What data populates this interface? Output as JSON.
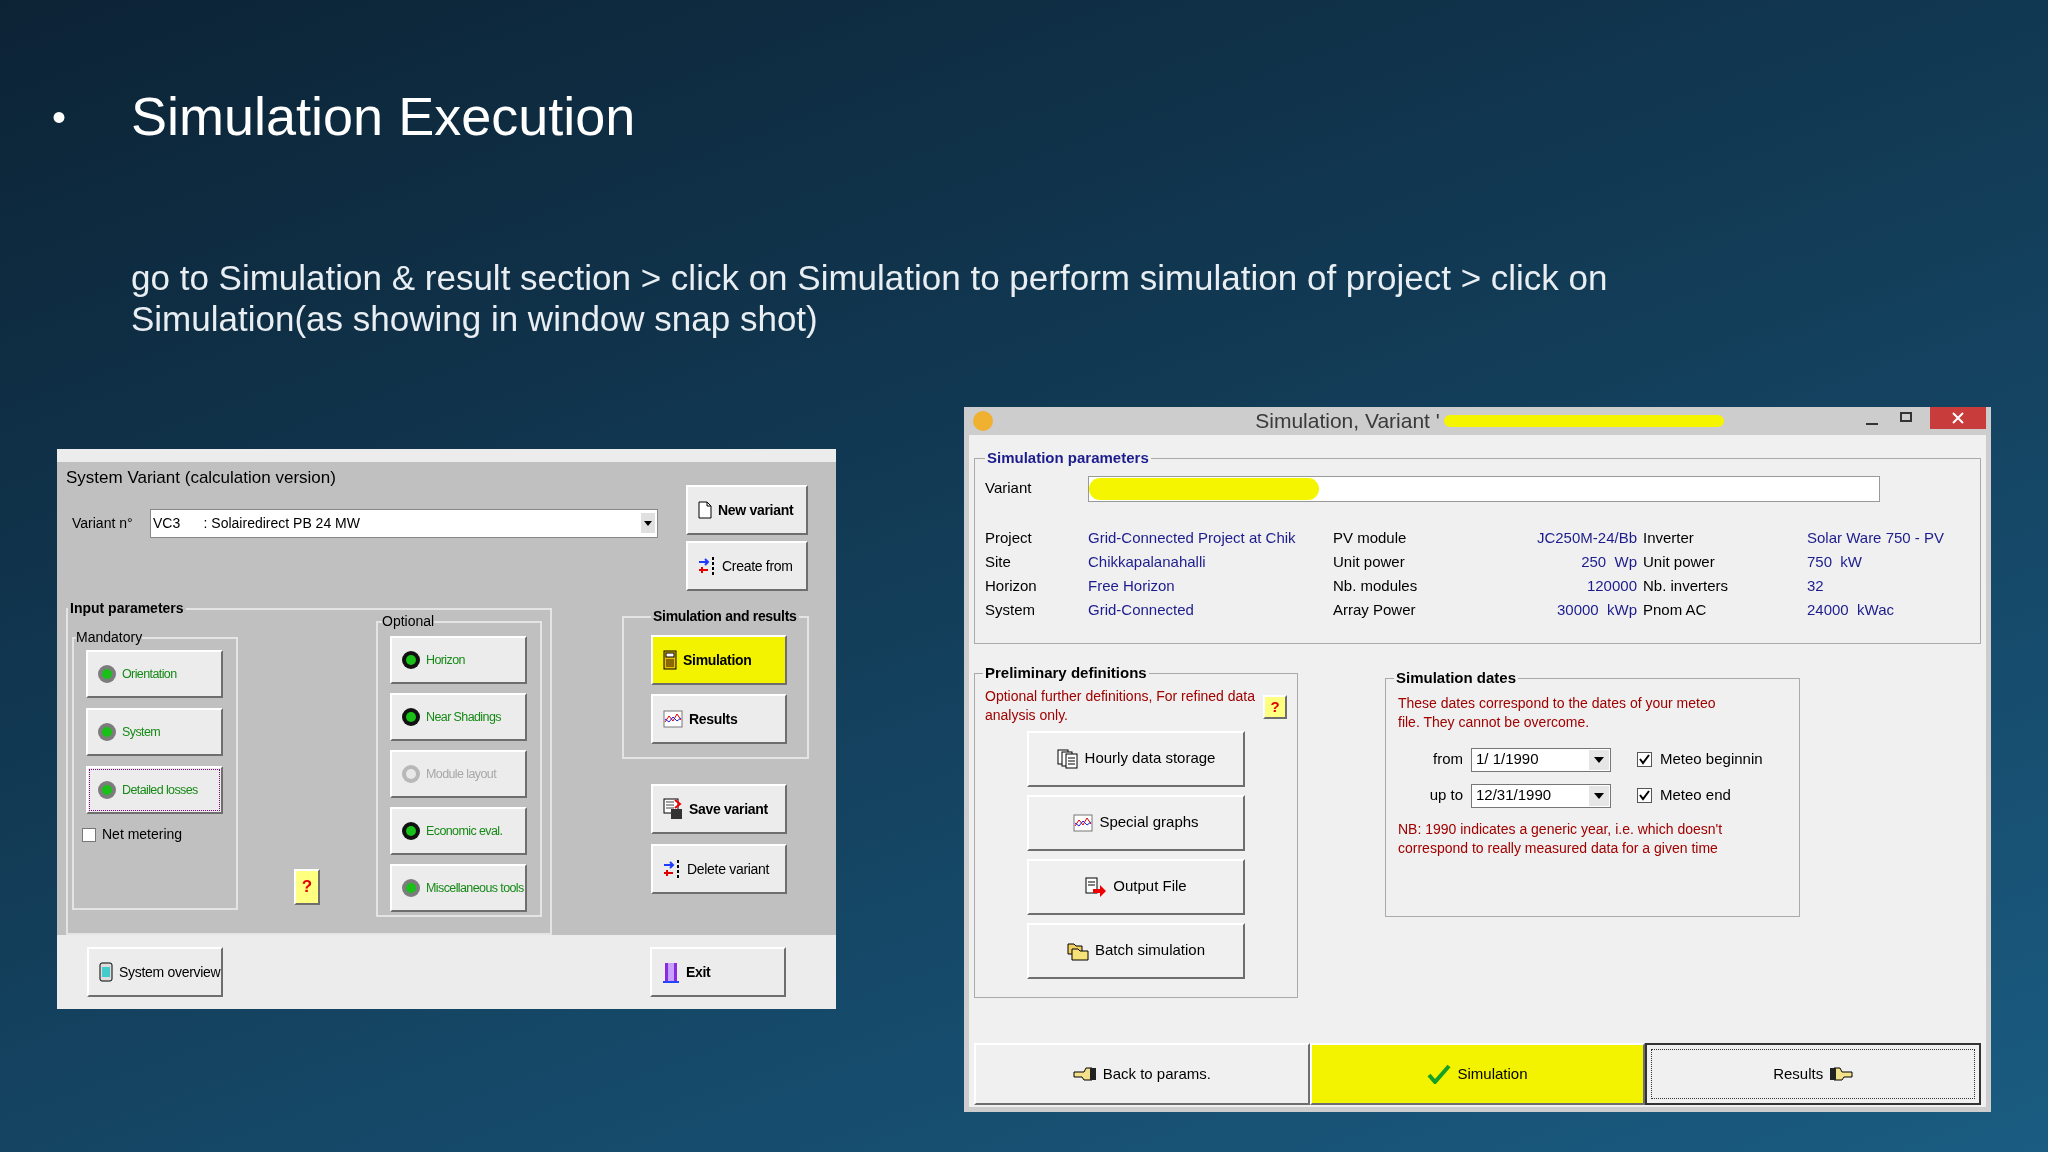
{
  "slide": {
    "bullet": "•",
    "title": "Simulation Execution",
    "body_lines": [
      "go to Simulation & result section > click on Simulation to perform simulation of project > click on",
      "Simulation(as showing in window snap shot)"
    ]
  },
  "variant_window": {
    "title": "System Variant (calculation version)",
    "variant_label": "Variant n°",
    "variant_value": "VC3      : Solairedirect PB 24 MW",
    "top_buttons": [
      {
        "label": "New variant"
      },
      {
        "label": "Create from"
      }
    ],
    "input_parameters": {
      "title": "Input parameters",
      "mandatory": {
        "title": "Mandatory",
        "buttons": [
          {
            "label": "Orientation",
            "kind": "ok",
            "disabled": false,
            "focused": false
          },
          {
            "label": "System",
            "kind": "ok",
            "disabled": false,
            "focused": false
          },
          {
            "label": "Detailed losses",
            "kind": "ok",
            "disabled": false,
            "focused": true
          }
        ],
        "net_metering": {
          "label": "Net metering",
          "checked": false
        }
      },
      "help": "?",
      "optional": {
        "title": "Optional",
        "buttons": [
          {
            "label": "Horizon",
            "kind": "dark",
            "disabled": false,
            "focused": false
          },
          {
            "label": "Near Shadings",
            "kind": "dark",
            "disabled": false,
            "focused": false
          },
          {
            "label": "Module layout",
            "kind": "off",
            "disabled": true,
            "focused": false
          },
          {
            "label": "Economic eval.",
            "kind": "dark",
            "disabled": false,
            "focused": false
          },
          {
            "label": "Miscellaneous tools",
            "kind": "ok",
            "disabled": false,
            "focused": false
          }
        ]
      }
    },
    "results_group": {
      "title": "Simulation and results",
      "buttons": [
        {
          "label": "Simulation",
          "highlighted": true
        },
        {
          "label": "Results",
          "highlighted": false
        }
      ]
    },
    "side_buttons": [
      {
        "label": "Save variant"
      },
      {
        "label": "Delete variant"
      }
    ],
    "bottom_buttons": [
      {
        "label": "System overview"
      },
      {
        "label": "Exit"
      }
    ]
  },
  "simulation_window": {
    "title": "Simulation, Variant '",
    "parameters": {
      "title": "Simulation parameters",
      "variant_label": "Variant",
      "rows": [
        {
          "items": [
            {
              "label": "Project",
              "value": "Grid-Connected Project at Chik"
            },
            {
              "label": "PV module",
              "value": "JC250M-24/Bb"
            },
            {
              "label": "Inverter",
              "value": "Solar Ware 750 - PV"
            }
          ]
        },
        {
          "items": [
            {
              "label": "Site",
              "value": "Chikkapalanahalli"
            },
            {
              "label": "Unit power",
              "value": "250  Wp"
            },
            {
              "label": "Unit power",
              "value": "750  kW"
            }
          ]
        },
        {
          "items": [
            {
              "label": "Horizon",
              "value": "Free Horizon"
            },
            {
              "label": "Nb. modules",
              "value": "120000"
            },
            {
              "label": "Nb. inverters",
              "value": "32"
            }
          ]
        },
        {
          "items": [
            {
              "label": "System",
              "value": "Grid-Connected"
            },
            {
              "label": "Array Power",
              "value": "30000  kWp"
            },
            {
              "label": "Pnom AC",
              "value": "24000  kWac"
            }
          ]
        }
      ]
    },
    "preliminary": {
      "title": "Preliminary definitions",
      "note": "Optional further definitions, For refined data analysis only.",
      "help": "?",
      "buttons": [
        {
          "label": "Hourly data storage"
        },
        {
          "label": "Special graphs"
        },
        {
          "label": "Output File"
        },
        {
          "label": "Batch simulation"
        }
      ]
    },
    "dates": {
      "title": "Simulation dates",
      "note": "These dates correspond to the dates of  your meteo file. They cannot be overcome.",
      "rows": [
        {
          "label": "from",
          "value": "1/ 1/1990",
          "check_label": "Meteo beginnin",
          "checked": true
        },
        {
          "label": "up to",
          "value": "12/31/1990",
          "check_label": "Meteo end",
          "checked": true
        }
      ],
      "nb": "NB: 1990 indicates a generic year, i.e. which doesn't correspond to really measured data for a given time"
    },
    "footer_buttons": [
      {
        "label": "Back to params.",
        "highlighted": false,
        "focused": false
      },
      {
        "label": "Simulation",
        "highlighted": true,
        "focused": false
      },
      {
        "label": "Results",
        "highlighted": false,
        "focused": true
      }
    ]
  }
}
